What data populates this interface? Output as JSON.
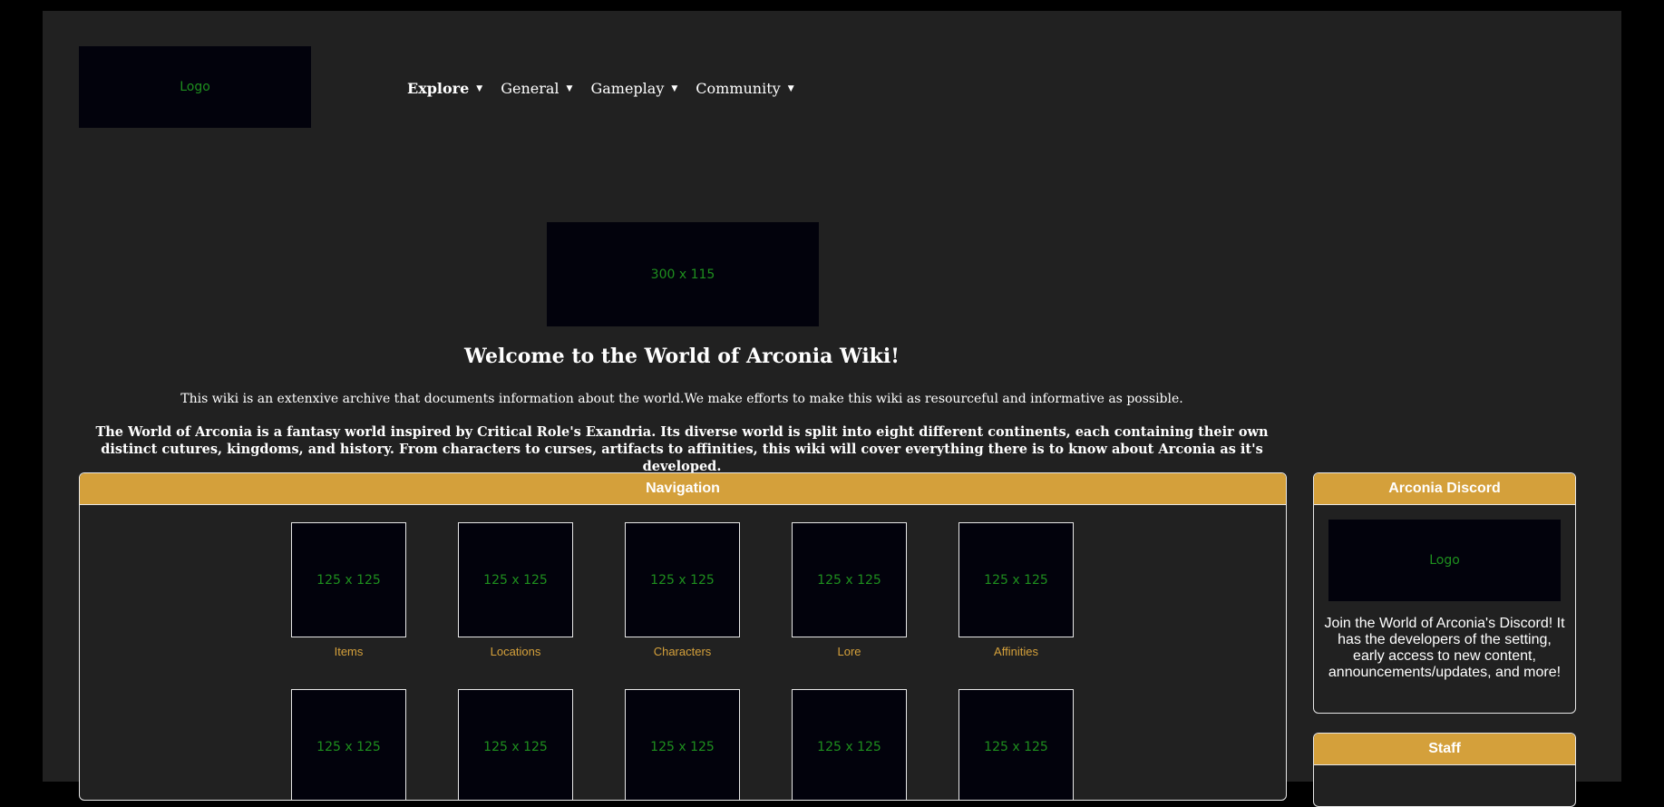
{
  "header": {
    "logo_text": "Logo",
    "nav": [
      {
        "label": "Explore"
      },
      {
        "label": "General"
      },
      {
        "label": "Gameplay"
      },
      {
        "label": "Community"
      }
    ],
    "caret_glyph": "▼"
  },
  "hero": {
    "banner_text": "300 x 115",
    "title": "Welcome to the World of Arconia Wiki!",
    "intro": "This wiki is an extenxive archive that documents information about the world.We make efforts to make this wiki as resourceful and informative as possible.",
    "description": "The World of Arconia is a fantasy world inspired by Critical Role's Exandria. Its diverse world is split into eight different continents, each containing their own distinct cutures, kingdoms, and history. From characters to curses, artifacts to affinities, this wiki will cover everything there is to know about Arconia as it's developed."
  },
  "navigation_panel": {
    "title": "Navigation",
    "row1": [
      {
        "placeholder": "125 x 125",
        "label": "Items"
      },
      {
        "placeholder": "125 x 125",
        "label": "Locations"
      },
      {
        "placeholder": "125 x 125",
        "label": "Characters"
      },
      {
        "placeholder": "125 x 125",
        "label": "Lore"
      },
      {
        "placeholder": "125 x 125",
        "label": "Affinities"
      }
    ],
    "row2": [
      {
        "placeholder": "125 x 125"
      },
      {
        "placeholder": "125 x 125"
      },
      {
        "placeholder": "125 x 125"
      },
      {
        "placeholder": "125 x 125"
      },
      {
        "placeholder": "125 x 125"
      }
    ]
  },
  "discord_panel": {
    "title": "Arconia Discord",
    "logo_text": "Logo",
    "text": "Join the World of Arconia's Discord! It has the developers of the setting, early access to new content, announcements/updates, and more!"
  },
  "staff_panel": {
    "title": "Staff"
  },
  "colors": {
    "accent": "#d4a03b",
    "page_bg": "#212121",
    "placeholder_bg": "#02020c",
    "placeholder_text": "#1e8f1e"
  }
}
